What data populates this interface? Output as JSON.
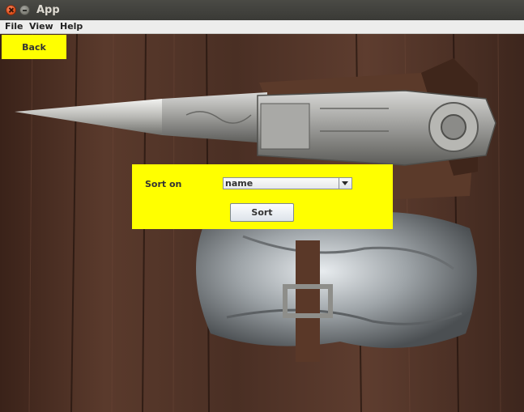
{
  "window": {
    "title": "App"
  },
  "menu": {
    "items": [
      "File",
      "View",
      "Help"
    ]
  },
  "back_button": {
    "label": "Back"
  },
  "sort_panel": {
    "label": "Sort on",
    "selected": "name",
    "sort_button": "Sort"
  },
  "colors": {
    "panel": "#ffff00",
    "wood": "#4a3025",
    "titlebar": "#3c3b37"
  },
  "icons": [
    "close-icon",
    "minimize-icon",
    "chevron-down-icon"
  ]
}
